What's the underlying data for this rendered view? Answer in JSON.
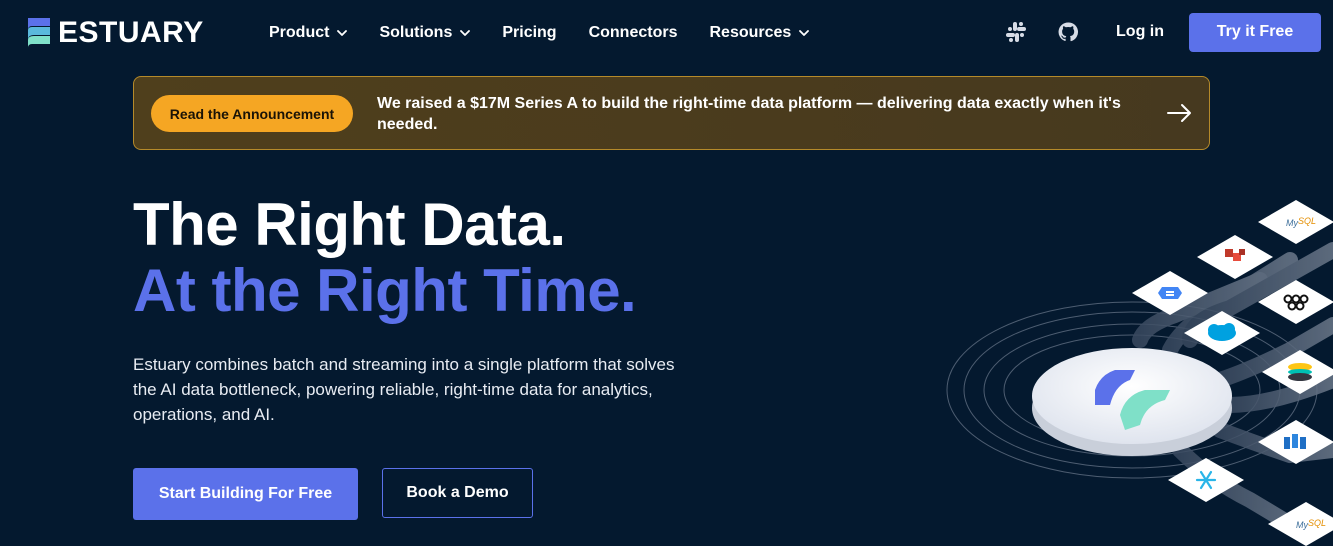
{
  "brand": {
    "name": "ESTUARY"
  },
  "nav": {
    "items": [
      {
        "label": "Product",
        "has_dropdown": true
      },
      {
        "label": "Solutions",
        "has_dropdown": true
      },
      {
        "label": "Pricing",
        "has_dropdown": false
      },
      {
        "label": "Connectors",
        "has_dropdown": false
      },
      {
        "label": "Resources",
        "has_dropdown": true
      }
    ],
    "icons": [
      "slack-icon",
      "github-icon"
    ],
    "login_label": "Log in",
    "cta_label": "Try it Free"
  },
  "announcement": {
    "pill_label": "Read the Announcement",
    "text": "We raised a $17M Series A to build the right-time data platform — delivering data exactly when it's needed.",
    "arrow_icon": "arrow-right-icon"
  },
  "hero": {
    "title_line1": "The Right Data.",
    "title_line2": "At the Right Time.",
    "description": "Estuary combines batch and streaming into a single platform that solves the AI data bottleneck, powering reliable, right-time data for analytics, operations, and AI.",
    "primary_cta": "Start Building For Free",
    "secondary_cta": "Book a Demo"
  },
  "illustration": {
    "connector_tiles": [
      "mysql-logo",
      "redshift-logo",
      "bigquery-logo",
      "kafka-logo",
      "salesforce-logo",
      "elastic-logo",
      "azure-synapse-logo",
      "snowflake-logo",
      "mysql-logo"
    ]
  },
  "colors": {
    "background": "#04192f",
    "accent": "#5b71ea",
    "announcement_pill": "#f5a623",
    "announcement_border": "#b58a2a"
  }
}
